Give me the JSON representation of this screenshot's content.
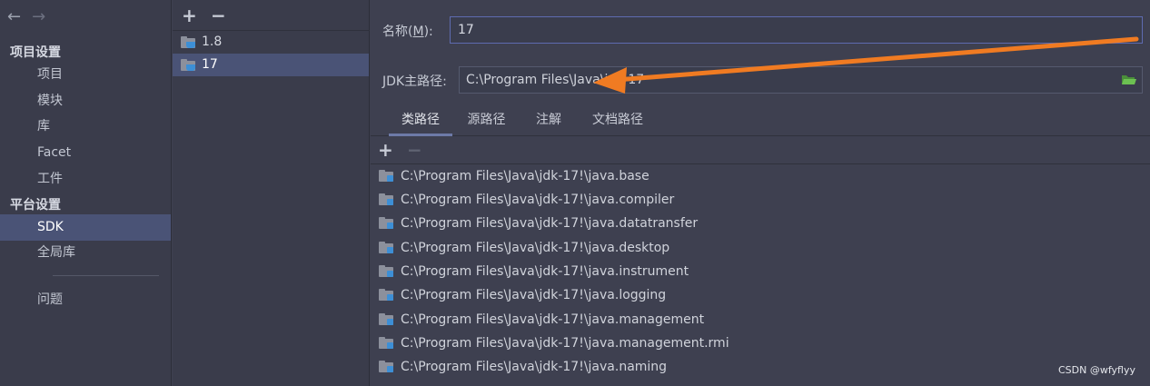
{
  "nav": {
    "back_glyph": "←",
    "forward_glyph": "→",
    "section_project": "项目设置",
    "project_items": [
      "项目",
      "模块",
      "库",
      "Facet",
      "工件"
    ],
    "section_platform": "平台设置",
    "platform_items": [
      "SDK",
      "全局库"
    ],
    "problems": "问题",
    "selected_item": "SDK"
  },
  "sdk_list": {
    "add_glyph": "+",
    "remove_glyph": "−",
    "items": [
      "1.8",
      "17"
    ],
    "selected": "17"
  },
  "details": {
    "name_label_prefix": "名称(",
    "name_label_mnemonic": "M",
    "name_label_suffix": "):",
    "name_value": "17",
    "jdk_path_label": "JDK主路径:",
    "jdk_path_value": "C:\\Program Files\\Java\\jdk-17",
    "tabs": [
      "类路径",
      "源路径",
      "注解",
      "文档路径"
    ],
    "active_tab": "类路径",
    "add_glyph": "+",
    "remove_glyph": "−",
    "class_paths": [
      "C:\\Program Files\\Java\\jdk-17!\\java.base",
      "C:\\Program Files\\Java\\jdk-17!\\java.compiler",
      "C:\\Program Files\\Java\\jdk-17!\\java.datatransfer",
      "C:\\Program Files\\Java\\jdk-17!\\java.desktop",
      "C:\\Program Files\\Java\\jdk-17!\\java.instrument",
      "C:\\Program Files\\Java\\jdk-17!\\java.logging",
      "C:\\Program Files\\Java\\jdk-17!\\java.management",
      "C:\\Program Files\\Java\\jdk-17!\\java.management.rmi",
      "C:\\Program Files\\Java\\jdk-17!\\java.naming"
    ]
  },
  "watermark": "CSDN @wfyflyy",
  "colors": {
    "selection": "#4a5376",
    "annotation_arrow": "#f07b22",
    "folder_open_icon": "#5fb04a"
  },
  "icons": {
    "sdk_item": "jdk-folder-icon",
    "path_item": "library-folder-icon",
    "browse": "open-folder-icon"
  }
}
